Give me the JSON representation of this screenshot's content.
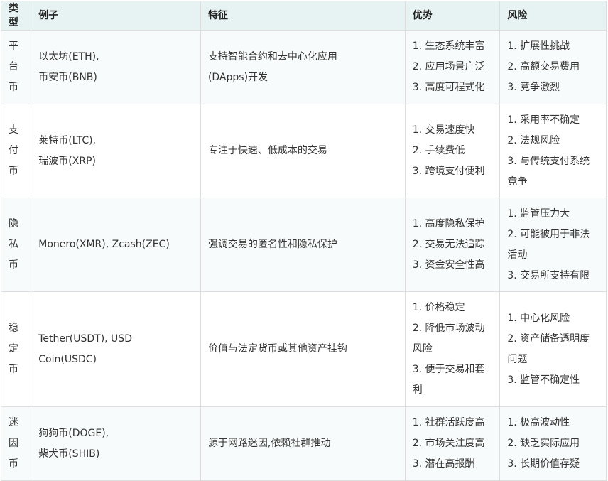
{
  "table": {
    "headers": [
      "类型",
      "例子",
      "特征",
      "优势",
      "风险"
    ],
    "rows": [
      {
        "type": [
          "平台",
          "币"
        ],
        "examples": [
          "以太坊(ETH),",
          "币安币(BNB)"
        ],
        "features": [
          "支持智能合约和去中心化应用",
          "(DApps)开发"
        ],
        "advantages": [
          "1. 生态系统丰富",
          "2. 应用场景广泛",
          "3. 高度可程式化"
        ],
        "risks": [
          "1. 扩展性挑战",
          "2. 高额交易费用",
          "3. 竞争激烈"
        ]
      },
      {
        "type": [
          "支付",
          "币"
        ],
        "examples": [
          "莱特币(LTC),",
          "瑞波币(XRP)"
        ],
        "features": [
          "专注于快速、低成本的交易"
        ],
        "advantages": [
          "1. 交易速度快",
          "2. 手续费低",
          "3. 跨境支付便利"
        ],
        "risks": [
          "1. 采用率不确定",
          "2. 法规风险",
          "3. 与传统支付系统",
          "竞争"
        ]
      },
      {
        "type": [
          "隐私",
          "币"
        ],
        "examples": [
          "Monero(XMR), Zcash(ZEC)"
        ],
        "features": [
          "强调交易的匿名性和隐私保护"
        ],
        "advantages": [
          "1. 高度隐私保护",
          "2. 交易无法追踪",
          "3. 资金安全性高"
        ],
        "risks": [
          "1. 监管压力大",
          "2. 可能被用于非法",
          "活动",
          "3. 交易所支持有限"
        ]
      },
      {
        "type": [
          "稳定",
          "币"
        ],
        "examples": [
          "Tether(USDT), USD",
          "Coin(USDC)"
        ],
        "features": [
          "价值与法定货币或其他资产挂钩"
        ],
        "advantages": [
          "1. 价格稳定",
          "2. 降低市场波动",
          "风险",
          "3. 便于交易和套",
          "利"
        ],
        "risks": [
          "1. 中心化风险",
          "2. 资产储备透明度",
          "问题",
          "3. 监管不确定性"
        ]
      },
      {
        "type": [
          "迷因",
          "币"
        ],
        "examples": [
          "狗狗币(DOGE),",
          "柴犬币(SHIB)"
        ],
        "features": [
          "源于网路迷因,依赖社群推动"
        ],
        "advantages": [
          "1. 社群活跃度高",
          "2. 市场关注度高",
          "3. 潜在高报酬"
        ],
        "risks": [
          "1. 极高波动性",
          "2. 缺乏实际应用",
          "3. 长期价值存疑"
        ]
      }
    ]
  }
}
